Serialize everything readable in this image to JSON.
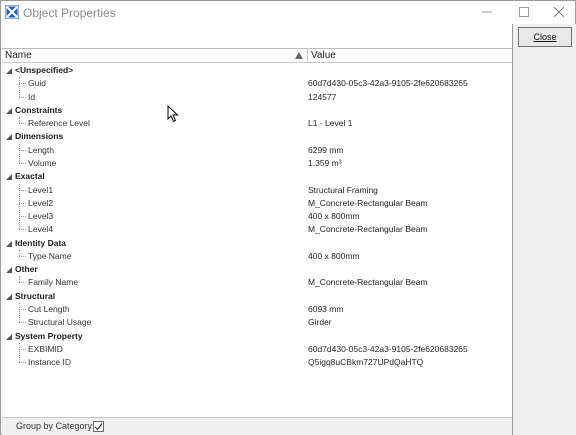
{
  "window": {
    "title": "Object Properties"
  },
  "columns": {
    "name": "Name",
    "value": "Value"
  },
  "categories": [
    {
      "label": "<Unspecified>",
      "props": [
        {
          "name": "Guid",
          "value": "60d7d430-05c3-42a3-9105-2fe620683265"
        },
        {
          "name": "Id",
          "value": "124577"
        }
      ]
    },
    {
      "label": "Constraints",
      "props": [
        {
          "name": "Reference Level",
          "value": "L1 - Level 1"
        }
      ]
    },
    {
      "label": "Dimensions",
      "props": [
        {
          "name": "Length",
          "value": "6299 mm"
        },
        {
          "name": "Volume",
          "value": "1.359 m³"
        }
      ]
    },
    {
      "label": "Exactal",
      "props": [
        {
          "name": "Level1",
          "value": "Structural Framing"
        },
        {
          "name": "Level2",
          "value": "M_Concrete-Rectangular Beam"
        },
        {
          "name": "Level3",
          "value": "400 x 800mm"
        },
        {
          "name": "Level4",
          "value": "M_Concrete-Rectangular Beam"
        }
      ]
    },
    {
      "label": "Identity Data",
      "props": [
        {
          "name": "Type Name",
          "value": "400 x 800mm"
        }
      ]
    },
    {
      "label": "Other",
      "props": [
        {
          "name": "Family Name",
          "value": "M_Concrete-Rectangular Beam"
        }
      ]
    },
    {
      "label": "Structural",
      "props": [
        {
          "name": "Cut Length",
          "value": "6093 mm"
        },
        {
          "name": "Structural Usage",
          "value": "Girder"
        }
      ]
    },
    {
      "label": "System Property",
      "props": [
        {
          "name": "EXBIMID",
          "value": "60d7d430-05c3-42a3-9105-2fe620683265"
        },
        {
          "name": "Instance ID",
          "value": "Q5igq8uCBkm727UPdQaHTQ"
        }
      ]
    }
  ],
  "footer": {
    "group_by_label": "Group by Category:",
    "group_by_checked": true
  },
  "actions": {
    "close_label": "Close"
  },
  "colors": {
    "app_icon": "#1f5fbf",
    "tree_line": "#999999"
  }
}
